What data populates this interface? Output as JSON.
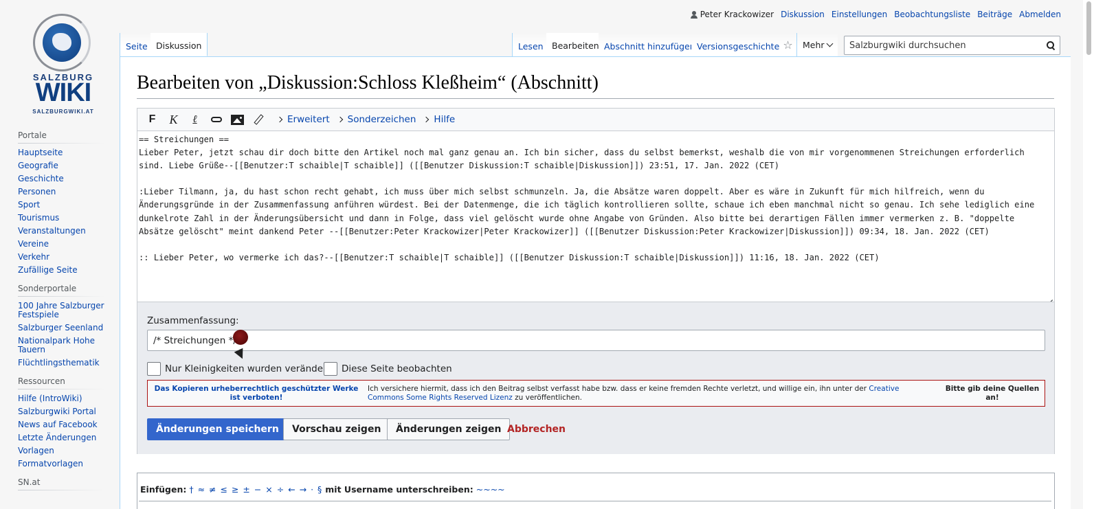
{
  "logo": {
    "line1": "SALZBURG",
    "line2": "WIKI",
    "line3": "SALZBURGWIKI.AT"
  },
  "personal": {
    "user": "Peter Krackowizer",
    "links": [
      "Diskussion",
      "Einstellungen",
      "Beobachtungsliste",
      "Beiträge",
      "Abmelden"
    ]
  },
  "tabs": {
    "left": [
      "Seite",
      "Diskussion"
    ],
    "right": [
      "Lesen",
      "Bearbeiten",
      "Abschnitt hinzufügen",
      "Versionsgeschichte"
    ],
    "star_icon": "star-icon",
    "more": "Mehr"
  },
  "search": {
    "placeholder": "Salzburgwiki durchsuchen"
  },
  "sidebar": {
    "portlets": [
      {
        "title": "Portale",
        "items": [
          "Hauptseite",
          "Geografie",
          "Geschichte",
          "Personen",
          "Sport",
          "Tourismus",
          "Veranstaltungen",
          "Vereine",
          "Verkehr",
          "Zufällige Seite"
        ]
      },
      {
        "title": "Sonderportale",
        "items": [
          "100 Jahre Salzburger Festspiele",
          "Salzburger Seenland",
          "Nationalpark Hohe Tauern",
          "Flüchtlingsthematik"
        ]
      },
      {
        "title": "Ressourcen",
        "items": [
          "Hilfe (IntroWiki)",
          "Salzburgwiki Portal",
          "News auf Facebook",
          "Letzte Änderungen",
          "Vorlagen",
          "Formatvorlagen"
        ]
      },
      {
        "title": "SN.at",
        "items": []
      }
    ]
  },
  "heading": "Bearbeiten von „Diskussion:Schloss Kleßheim“ (Abschnitt)",
  "toolbar": {
    "bold": "F",
    "italic": "K",
    "groups": [
      "Erweitert",
      "Sonderzeichen",
      "Hilfe"
    ]
  },
  "editor": {
    "text": "== Streichungen ==\nLieber Peter, jetzt schau dir doch bitte den Artikel noch mal ganz genau an. Ich bin sicher, dass du selbst bemerkst, weshalb die von mir vorgenommenen Streichungen erforderlich sind. Liebe Grüße--[[Benutzer:T schaible|T schaible]] ([[Benutzer Diskussion:T schaible|Diskussion]]) 23:51, 17. Jan. 2022 (CET)\n\n:Lieber Tilmann, ja, du hast schon recht gehabt, ich muss über mich selbst schmunzeln. Ja, die Absätze waren doppelt. Aber es wäre in Zukunft für mich hilfreich, wenn du Änderungsgründe in der Zusammenfassung anführen würdest. Bei der Datenmenge, die ich täglich kontrollieren sollte, schaue ich eben manchmal nicht so genau. Ich sehe lediglich eine dunkelrote Zahl in der Änderungsübersicht und dann in Folge, dass viel gelöscht wurde ohne Angabe von Gründen. Also bitte bei derartigen Fällen immer vermerken z. B. \"doppelte Absätze gelöscht\" meint dankend Peter --[[Benutzer:Peter Krackowizer|Peter Krackowizer]] ([[Benutzer Diskussion:Peter Krackowizer|Diskussion]]) 09:34, 18. Jan. 2022 (CET)\n\n:: Lieber Peter, wo vermerke ich das?--[[Benutzer:T schaible|T schaible]] ([[Benutzer Diskussion:T schaible|Diskussion]]) 11:16, 18. Jan. 2022 (CET)"
  },
  "options": {
    "summary_label": "Zusammenfassung:",
    "summary_value": "/* Streichungen */",
    "minor_label": "Nur Kleinigkeiten wurden verändert",
    "watch_label": "Diese Seite beobachten",
    "copy_warning_1": "Das Kopieren urheberrechtlich geschützter Werke ist verboten!",
    "copy_warning_2a": "Ich versichere hiermit, dass ich den Beitrag selbst verfasst habe bzw. dass er keine fremden Rechte verletzt, und willige ein, ihn unter der ",
    "copy_warning_2_link": "Creative Commons Some Rights Reserved Lizenz",
    "copy_warning_2b": " zu veröffentlichen.",
    "copy_warning_3": "Bitte gib deine Quellen an!",
    "save": "Änderungen speichern",
    "preview": "Vorschau zeigen",
    "diff": "Änderungen zeigen",
    "cancel": "Abbrechen"
  },
  "charinsert": {
    "label": "Einfügen:",
    "chars": "† ≈ ≠ ≤ ≥ ± − × ÷ ← → · §",
    "sig_label": "mit Username unterschreiben:",
    "sig": "~~~~"
  }
}
